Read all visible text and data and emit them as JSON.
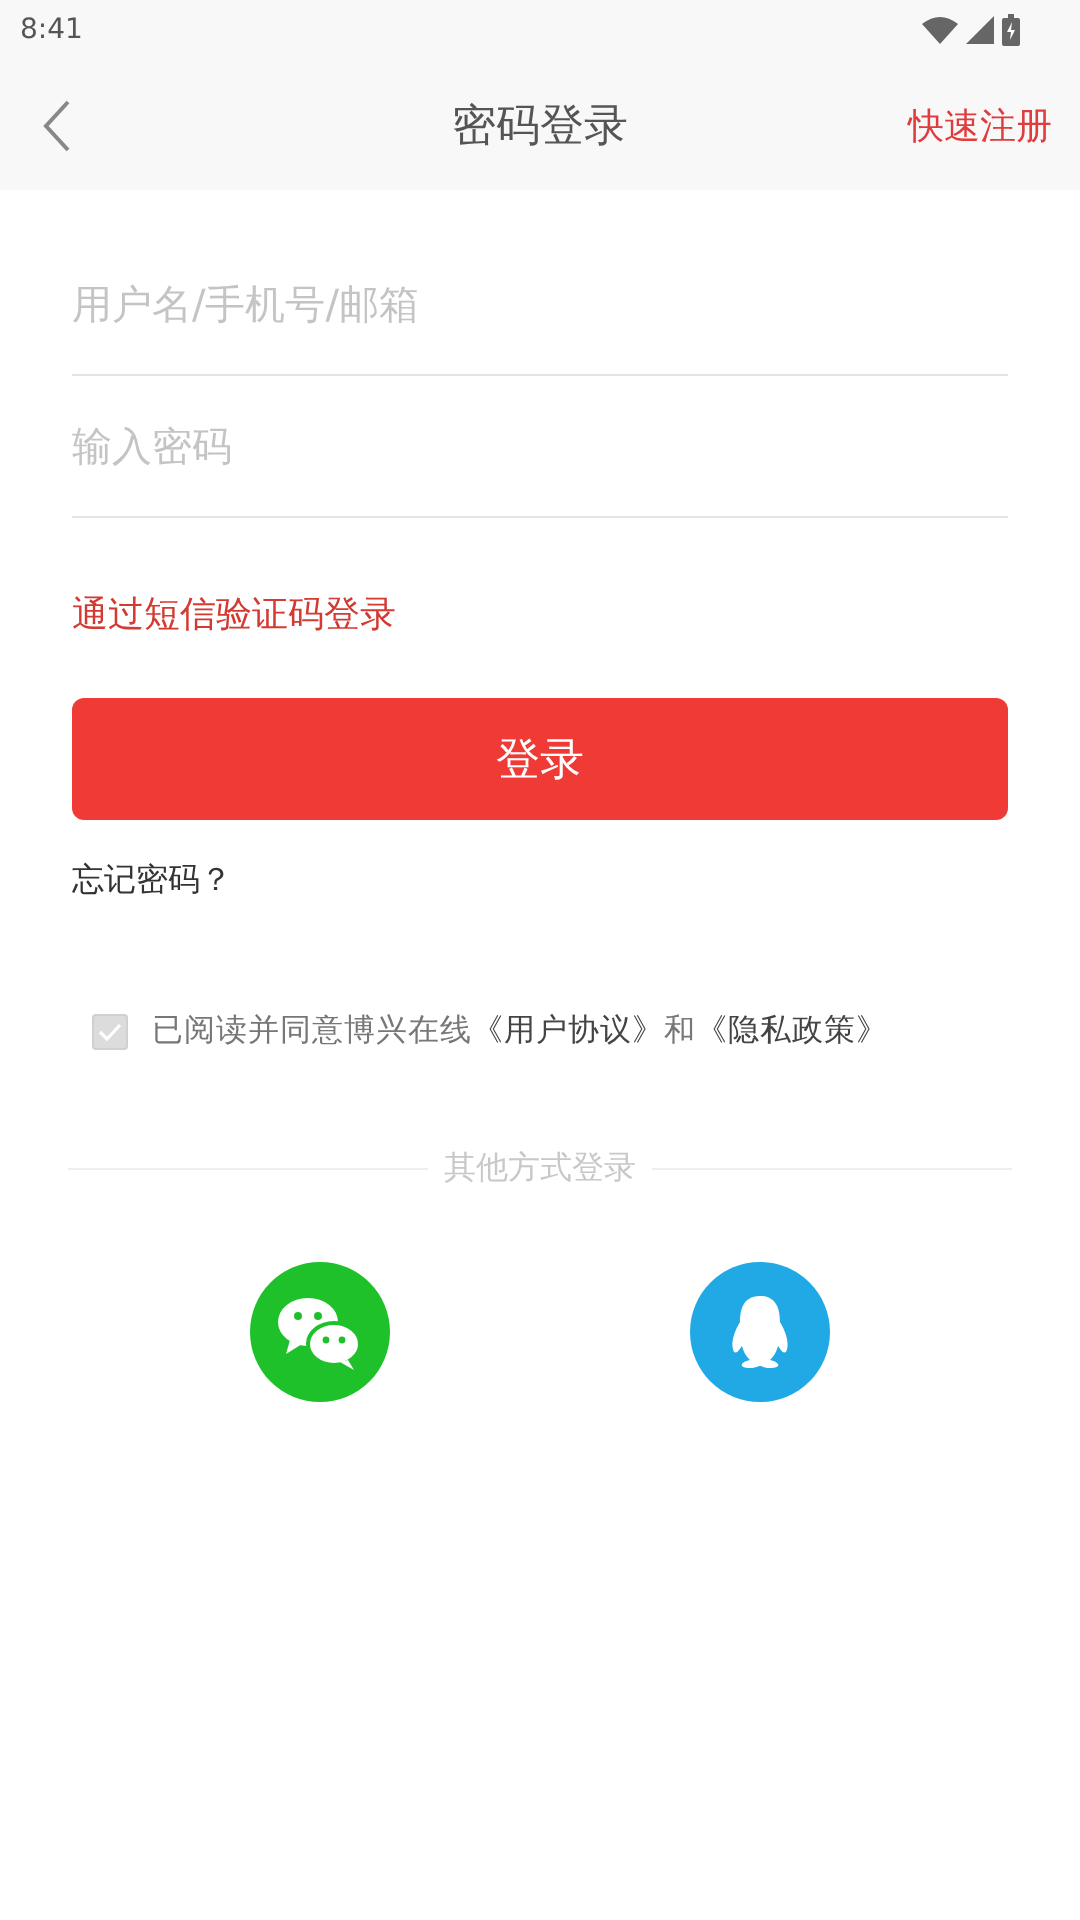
{
  "status_bar": {
    "time": "8:41"
  },
  "header": {
    "title": "密码登录",
    "action": "快速注册"
  },
  "form": {
    "fields": [
      {
        "placeholder": "用户名/手机号/邮箱"
      },
      {
        "placeholder": "输入密码"
      }
    ],
    "sms_login_link": "通过短信验证码登录",
    "login_button": "登录",
    "forgot_password": "忘记密码？"
  },
  "agreement": {
    "checked": true,
    "prefix": "已阅读并同意博兴在线",
    "links": [
      "《用户协议》",
      "《隐私政策》"
    ],
    "joiner": "和"
  },
  "other_login": {
    "title": "其他方式登录",
    "providers": [
      {
        "kind": "wechat"
      },
      {
        "kind": "qq"
      }
    ]
  }
}
